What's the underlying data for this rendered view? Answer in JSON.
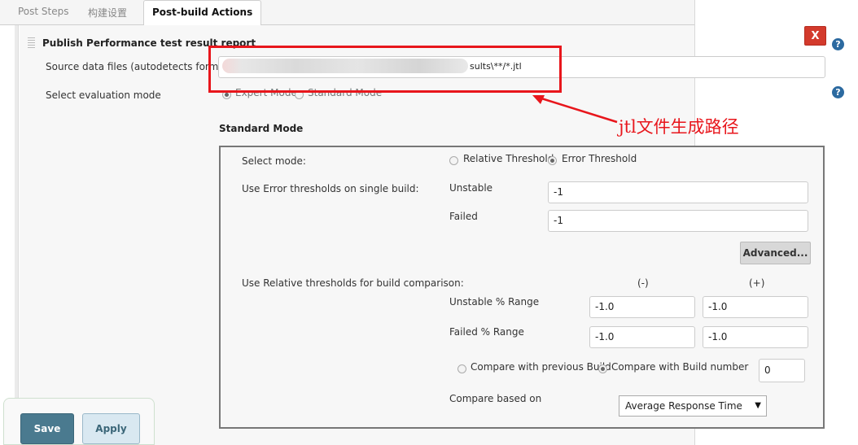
{
  "tabs": [
    "Post Steps",
    "构建设置",
    "Post-build Actions"
  ],
  "section": {
    "title": "Publish Performance test result report",
    "delete_label": "X",
    "help_label": "?"
  },
  "source": {
    "label": "Source data files (autodetects format)",
    "value_visible": "sults\\**/*.jtl"
  },
  "eval_mode": {
    "label": "Select evaluation mode",
    "options": [
      "Expert Mode",
      "Standard Mode"
    ],
    "selected": "Expert Mode"
  },
  "annotation": {
    "text": "jtl文件生成路径",
    "color": "#e8161c"
  },
  "standard": {
    "title": "Standard Mode",
    "select_mode_label": "Select mode:",
    "mode_options": [
      "Relative Threshold",
      "Error Threshold"
    ],
    "mode_selected": "Error Threshold",
    "error_label": "Use Error thresholds on single build:",
    "unstable_label": "Unstable",
    "unstable_value": "-1",
    "failed_label": "Failed",
    "failed_value": "-1",
    "advanced_label": "Advanced...",
    "relative_label": "Use Relative thresholds for build comparison:",
    "minus_header": "(-)",
    "plus_header": "(+)",
    "unstable_range_label": "Unstable % Range",
    "unstable_range_minus": "-1.0",
    "unstable_range_plus": "-1.0",
    "failed_range_label": "Failed % Range",
    "failed_range_minus": "-1.0",
    "failed_range_plus": "-1.0",
    "compare_options": [
      "Compare with previous Build",
      "Compare with Build number"
    ],
    "compare_selected": "Compare with Build number",
    "build_number": "0",
    "compare_based_label": "Compare based on",
    "compare_based_value": "Average Response Time"
  },
  "buttons": {
    "save": "Save",
    "apply": "Apply"
  },
  "colors": {
    "accent": "#4a7a8f",
    "delete": "#d33a2c",
    "help": "#2c6aa0"
  }
}
